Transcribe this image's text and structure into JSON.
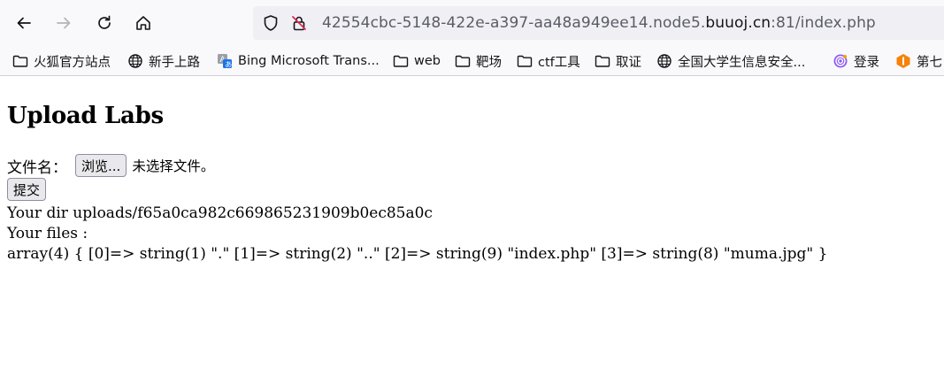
{
  "browser": {
    "url": {
      "prefix": "42554cbc-5148-422e-a397-aa48a949ee14.node5.",
      "host": "buuoj.cn",
      "suffix": ":81/index.php"
    }
  },
  "bookmarks": [
    {
      "label": "火狐官方站点",
      "icon": "folder-icon"
    },
    {
      "label": "新手上路",
      "icon": "globe-icon"
    },
    {
      "label": "Bing Microsoft Trans...",
      "icon": "translate-icon"
    },
    {
      "label": "web",
      "icon": "folder-icon"
    },
    {
      "label": "靶场",
      "icon": "folder-icon"
    },
    {
      "label": "ctf工具",
      "icon": "folder-icon"
    },
    {
      "label": "取证",
      "icon": "folder-icon"
    },
    {
      "label": "全国大学生信息安全...",
      "icon": "globe-icon"
    },
    {
      "label": "登录",
      "icon": "purple-spiral-icon"
    },
    {
      "label": "第七",
      "icon": "orange-logo-icon"
    }
  ],
  "page": {
    "title": "Upload Labs",
    "file_label": "文件名：",
    "browse_label": "浏览...",
    "no_file_text": "未选择文件。",
    "submit_label": "提交",
    "dir_line": "Your dir uploads/f65a0ca982c669865231909b0ec85a0c",
    "files_label": "Your files :",
    "files_dump": "array(4) { [0]=> string(1) \".\" [1]=> string(2) \"..\" [2]=> string(9) \"index.php\" [3]=> string(8) \"muma.jpg\" }"
  },
  "colors": {
    "toolbar_bg": "#f9f9fb",
    "urlbar_bg": "#f0f0f4",
    "url_dim": "#5b5b66",
    "button_bg": "#e9e9ed"
  }
}
